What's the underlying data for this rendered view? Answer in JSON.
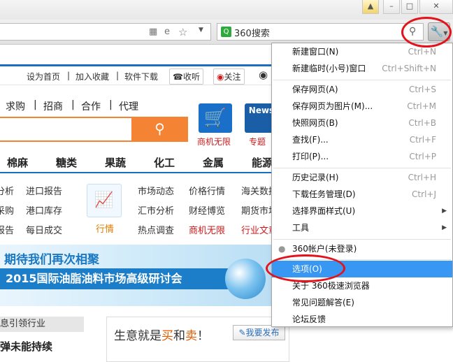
{
  "browser": {
    "search_engine": "360搜索",
    "search_logo_glyph": "Q",
    "window_buttons": [
      "shirt-icon",
      "minimize-icon",
      "maximize-icon",
      "close-icon"
    ]
  },
  "page": {
    "top_links": [
      "设为首页",
      "加入收藏",
      "软件下载",
      "收听",
      "关注"
    ],
    "category_links": [
      "求购",
      "招商",
      "合作",
      "代理"
    ],
    "promo_labels": [
      "商机无限",
      "专题"
    ],
    "promo_news_text": "News",
    "categories": [
      "棉麻",
      "糖类",
      "果蔬",
      "化工",
      "金属",
      "能源"
    ],
    "left_links": [
      "分析",
      "进口报告",
      "采购",
      "港口库存",
      "报告",
      "每日成交"
    ],
    "hangqing_label": "行情",
    "mid_links": [
      "市场动态",
      "价格行情",
      "海关数据",
      "汇市分析",
      "财经博览",
      "期货市场",
      "热点调查",
      "商机无限",
      "行业文章"
    ],
    "banner": {
      "line1": "期待我们再次相聚",
      "line2": "2015国际油脂油料市场高级研讨会"
    },
    "news_head": "息引领行业",
    "news_item": "弹未能持续",
    "biz": {
      "t1": "生意就是",
      "buy": "买",
      "and": "和",
      "sell": "卖",
      "bang": "！",
      "publish": "我要发布"
    }
  },
  "menu": {
    "items": [
      {
        "label": "新建窗口(N)",
        "shortcut": "Ctrl+N"
      },
      {
        "label": "新建临时(小号)窗口",
        "shortcut": "Ctrl+Shift+N"
      },
      {
        "label": "保存网页(A)",
        "shortcut": "Ctrl+S"
      },
      {
        "label": "保存网页为图片(M)...",
        "shortcut": "Ctrl+M"
      },
      {
        "label": "快照网页(B)",
        "shortcut": "Ctrl+B"
      },
      {
        "label": "查找(F)...",
        "shortcut": "Ctrl+F"
      },
      {
        "label": "打印(P)...",
        "shortcut": "Ctrl+P"
      },
      {
        "label": "历史记录(H)",
        "shortcut": "Ctrl+H"
      },
      {
        "label": "下载任务管理(D)",
        "shortcut": "Ctrl+J"
      },
      {
        "label": "选择界面样式(U)",
        "shortcut": ""
      },
      {
        "label": "工具",
        "shortcut": ""
      },
      {
        "label": "360帐户(未登录)",
        "shortcut": ""
      },
      {
        "label": "选项(O)",
        "shortcut": ""
      },
      {
        "label": "关于 360极速浏览器",
        "shortcut": ""
      },
      {
        "label": "常见问题解答(E)",
        "shortcut": ""
      },
      {
        "label": "论坛反馈",
        "shortcut": ""
      }
    ],
    "highlight_color": "#3797f3"
  },
  "annotation_color": "#e3131b"
}
